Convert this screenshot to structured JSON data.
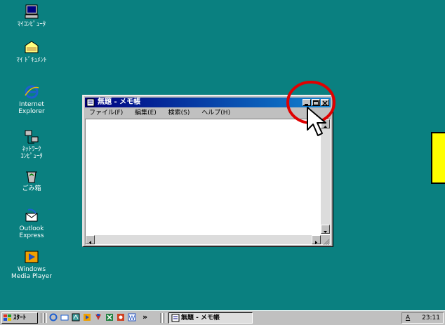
{
  "desktop_icons": [
    {
      "label": "ﾏｲｺﾝﾋﾟｭｰﾀ",
      "icon": "my-computer-icon"
    },
    {
      "label": "ﾏｲ ﾄﾞｷｭﾒﾝﾄ",
      "icon": "my-documents-icon"
    },
    {
      "label": "Internet\nExplorer",
      "icon": "internet-explorer-icon"
    },
    {
      "label": "ﾈｯﾄﾜｰｸ\nｺﾝﾋﾟｭｰﾀ",
      "icon": "network-computer-icon"
    },
    {
      "label": "ごみ箱",
      "icon": "recycle-bin-icon"
    },
    {
      "label": "Outlook\nExpress",
      "icon": "outlook-express-icon"
    },
    {
      "label": "Windows\nMedia Player",
      "icon": "media-player-icon"
    }
  ],
  "notepad": {
    "title": "無題 - メモ帳",
    "menu": [
      "ファイル(F)",
      "編集(E)",
      "検索(S)",
      "ヘルプ(H)"
    ]
  },
  "taskbar": {
    "start_label": "ｽﾀｰﾄ",
    "task_label": "無題 - メモ帳",
    "tray_indicator": "A",
    "clock": "23:11",
    "chevron": "»"
  },
  "colors": {
    "desktop": "#0a8080",
    "titlebar": "#000080",
    "highlight_circle": "#e00000",
    "callout": "#ffff00"
  }
}
